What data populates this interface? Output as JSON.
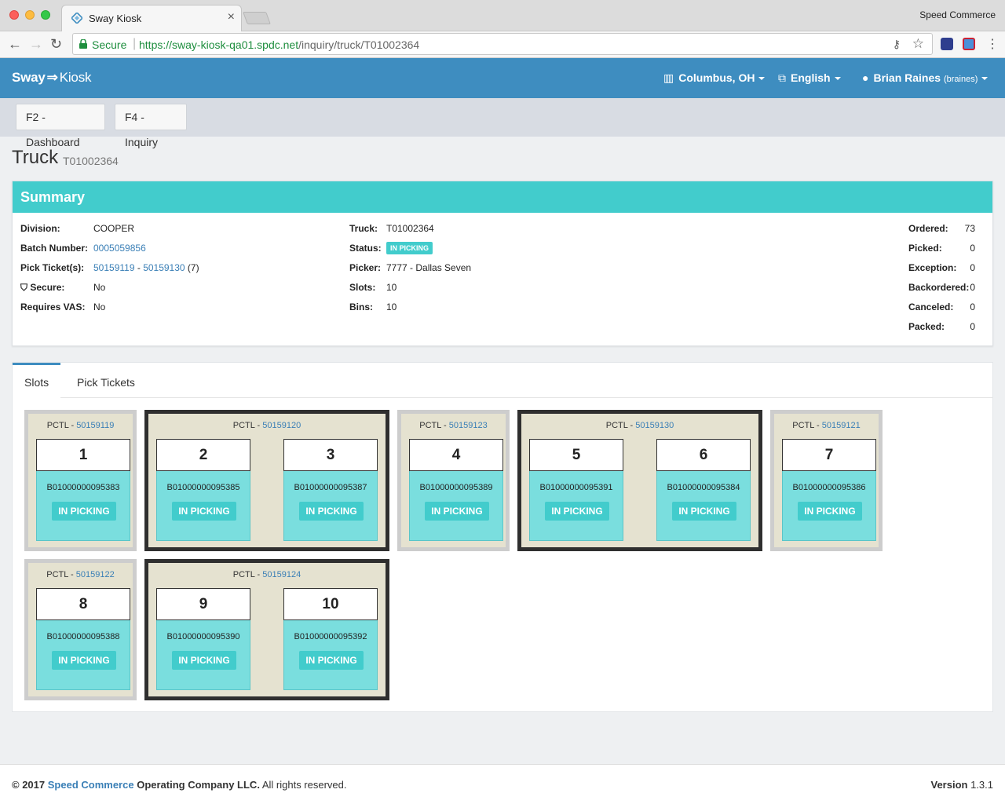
{
  "browser": {
    "tab_title": "Sway Kiosk",
    "tab_close": "×",
    "profile_name": "Speed Commerce",
    "secure_label": "Secure",
    "url_host": "https://sway-kiosk-qa01.spdc.net",
    "url_path": "/inquiry/truck/T01002364"
  },
  "header": {
    "brand_primary": "Sway",
    "brand_secondary": "Kiosk",
    "location": "Columbus, OH",
    "language": "English",
    "user_name": "Brian Raines",
    "user_login": "(braines)"
  },
  "toolbar": {
    "dashboard_label": "F2 - Dashboard",
    "inquiry_label": "F4 - Inquiry"
  },
  "page": {
    "title": "Truck",
    "subtitle": "T01002364"
  },
  "summary": {
    "heading": "Summary",
    "division_label": "Division:",
    "division": "COOPER",
    "batch_label": "Batch Number:",
    "batch": "0005059856",
    "pick_label": "Pick Ticket(s):",
    "pick_from": "50159119",
    "pick_sep": "-",
    "pick_to": "50159130",
    "pick_count": "(7)",
    "secure_label": "Secure:",
    "secure": "No",
    "vas_label": "Requires VAS:",
    "vas": "No",
    "truck_label": "Truck:",
    "truck": "T01002364",
    "status_label": "Status:",
    "status": "IN PICKING",
    "picker_label": "Picker:",
    "picker": "7777 - Dallas Seven",
    "slots_label": "Slots:",
    "slots": "10",
    "bins_label": "Bins:",
    "bins": "10",
    "ordered_label": "Ordered:",
    "ordered": "73",
    "picked_label": "Picked:",
    "picked": "0",
    "exception_label": "Exception:",
    "exception": "0",
    "backordered_label": "Backordered:",
    "backordered": "0",
    "canceled_label": "Canceled:",
    "canceled": "0",
    "packed_label": "Packed:",
    "packed": "0"
  },
  "tabs": {
    "slots": "Slots",
    "pick_tickets": "Pick Tickets"
  },
  "slot_status": "IN PICKING",
  "pctl_prefix": "PCTL -",
  "groups": [
    {
      "pctl": "50159119",
      "slots": [
        {
          "num": "1",
          "bin": "B01000000095383"
        }
      ]
    },
    {
      "pctl": "50159120",
      "slots": [
        {
          "num": "2",
          "bin": "B01000000095385"
        },
        {
          "num": "3",
          "bin": "B01000000095387"
        }
      ]
    },
    {
      "pctl": "50159123",
      "slots": [
        {
          "num": "4",
          "bin": "B01000000095389"
        }
      ]
    },
    {
      "pctl": "50159130",
      "slots": [
        {
          "num": "5",
          "bin": "B01000000095391"
        },
        {
          "num": "6",
          "bin": "B01000000095384"
        }
      ]
    },
    {
      "pctl": "50159121",
      "slots": [
        {
          "num": "7",
          "bin": "B01000000095386"
        }
      ]
    },
    {
      "pctl": "50159122",
      "slots": [
        {
          "num": "8",
          "bin": "B01000000095388"
        }
      ]
    },
    {
      "pctl": "50159124",
      "slots": [
        {
          "num": "9",
          "bin": "B01000000095390"
        },
        {
          "num": "10",
          "bin": "B01000000095392"
        }
      ]
    }
  ],
  "footer": {
    "copyright": "© 2017",
    "company_link": "Speed Commerce",
    "company_rest": "Operating Company LLC.",
    "rights": "All rights reserved.",
    "version_label": "Version",
    "version": "1.3.1"
  },
  "colors": {
    "header_blue": "#3e8dc0",
    "summary_teal": "#42cccc",
    "slot_teal": "#7adede",
    "slot_bg": "#e5e2d0",
    "link": "#3a7fb6"
  }
}
